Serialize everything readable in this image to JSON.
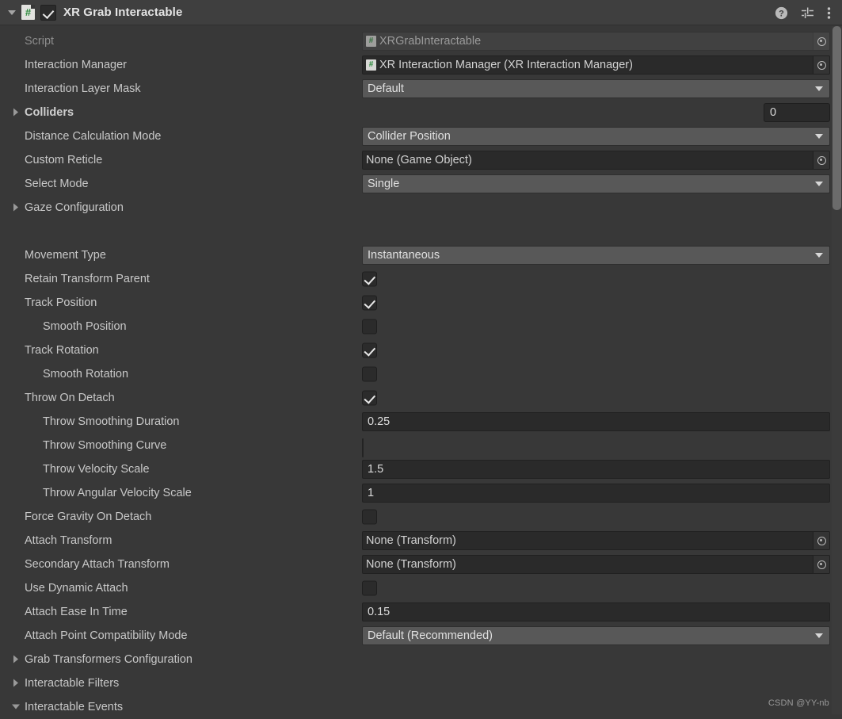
{
  "header": {
    "expand_icon": "triangle-down-icon",
    "script_icon_glyph": "#",
    "enabled": true,
    "title": "XR Grab Interactable",
    "help_icon": "help-icon",
    "preset_icon": "preset-icon",
    "menu_icon": "kebab-menu-icon"
  },
  "colors": {
    "panel_bg": "#383838",
    "header_bg": "#3f3f3f",
    "field_bg": "#2a2a2a",
    "popup_bg": "#585858",
    "label": "#c8c8c8",
    "curve_green": "#30c030",
    "script_green": "#2c8a3c"
  },
  "rows": [
    {
      "label": "Script",
      "indent": 0,
      "dim": true,
      "control": "object",
      "value": "XRGrabInteractable",
      "readonly": true,
      "has_script_icon": true
    },
    {
      "label": "Interaction Manager",
      "indent": 0,
      "control": "object",
      "value": "XR Interaction Manager (XR Interaction Manager)",
      "readonly": false,
      "has_script_icon": true
    },
    {
      "label": "Interaction Layer Mask",
      "indent": 0,
      "control": "popup",
      "value": "Default"
    },
    {
      "label": "Colliders",
      "indent": 0,
      "bold": true,
      "foldout": "right",
      "control": "size",
      "value": "0"
    },
    {
      "label": "Distance Calculation Mode",
      "indent": 0,
      "control": "popup",
      "value": "Collider Position"
    },
    {
      "label": "Custom Reticle",
      "indent": 0,
      "control": "object",
      "value": "None (Game Object)",
      "readonly": false,
      "has_script_icon": false
    },
    {
      "label": "Select Mode",
      "indent": 0,
      "control": "popup",
      "value": "Single"
    },
    {
      "label": "Gaze Configuration",
      "indent": 0,
      "foldout": "right",
      "control": "none"
    },
    {
      "label": "",
      "indent": 0,
      "control": "none",
      "spacer": true
    },
    {
      "label": "Movement Type",
      "indent": 0,
      "control": "popup",
      "value": "Instantaneous"
    },
    {
      "label": "Retain Transform Parent",
      "indent": 0,
      "control": "toggle",
      "checked": true
    },
    {
      "label": "Track Position",
      "indent": 0,
      "control": "toggle",
      "checked": true
    },
    {
      "label": "Smooth Position",
      "indent": 1,
      "control": "toggle",
      "checked": false
    },
    {
      "label": "Track Rotation",
      "indent": 0,
      "control": "toggle",
      "checked": true
    },
    {
      "label": "Smooth Rotation",
      "indent": 1,
      "control": "toggle",
      "checked": false
    },
    {
      "label": "Throw On Detach",
      "indent": 0,
      "control": "toggle",
      "checked": true
    },
    {
      "label": "Throw Smoothing Duration",
      "indent": 1,
      "control": "number",
      "value": "0.25"
    },
    {
      "label": "Throw Smoothing Curve",
      "indent": 1,
      "control": "curve"
    },
    {
      "label": "Throw Velocity Scale",
      "indent": 1,
      "control": "number",
      "value": "1.5"
    },
    {
      "label": "Throw Angular Velocity Scale",
      "indent": 1,
      "control": "number",
      "value": "1"
    },
    {
      "label": "Force Gravity On Detach",
      "indent": 0,
      "control": "toggle",
      "checked": false
    },
    {
      "label": "Attach Transform",
      "indent": 0,
      "control": "object",
      "value": "None (Transform)",
      "readonly": false,
      "has_script_icon": false
    },
    {
      "label": "Secondary Attach Transform",
      "indent": 0,
      "control": "object",
      "value": "None (Transform)",
      "readonly": false,
      "has_script_icon": false
    },
    {
      "label": "Use Dynamic Attach",
      "indent": 0,
      "control": "toggle",
      "checked": false
    },
    {
      "label": "Attach Ease In Time",
      "indent": 0,
      "control": "number",
      "value": "0.15"
    },
    {
      "label": "Attach Point Compatibility Mode",
      "indent": 0,
      "control": "popup",
      "value": "Default (Recommended)"
    },
    {
      "label": "Grab Transformers Configuration",
      "indent": 0,
      "foldout": "right",
      "control": "none"
    },
    {
      "label": "Interactable Filters",
      "indent": 0,
      "foldout": "right",
      "control": "none"
    },
    {
      "label": "Interactable Events",
      "indent": 0,
      "foldout": "down",
      "control": "none"
    }
  ],
  "watermark": "CSDN @YY-nb"
}
